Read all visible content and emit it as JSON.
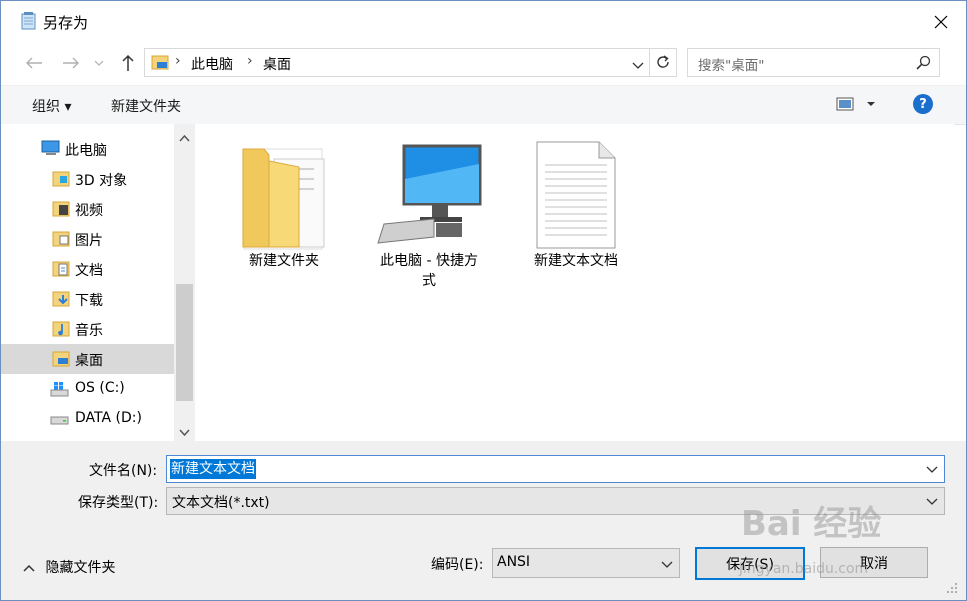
{
  "window": {
    "title": "另存为"
  },
  "address": {
    "crumbs": [
      "此电脑",
      "桌面"
    ]
  },
  "search": {
    "placeholder": "搜索\"桌面\""
  },
  "toolbar": {
    "organize": "组织 ▾",
    "new_folder": "新建文件夹"
  },
  "sidebar": {
    "items": [
      {
        "label": "此电脑",
        "icon": "pc-icon"
      },
      {
        "label": "3D 对象",
        "icon": "3d-objects-icon"
      },
      {
        "label": "视频",
        "icon": "videos-icon"
      },
      {
        "label": "图片",
        "icon": "pictures-icon"
      },
      {
        "label": "文档",
        "icon": "documents-icon"
      },
      {
        "label": "下载",
        "icon": "downloads-icon"
      },
      {
        "label": "音乐",
        "icon": "music-icon"
      },
      {
        "label": "桌面",
        "icon": "desktop-icon",
        "selected": true
      },
      {
        "label": "OS (C:)",
        "icon": "windows-drive-icon"
      },
      {
        "label": "DATA (D:)",
        "icon": "drive-icon"
      }
    ]
  },
  "files": [
    {
      "name": "新建文件夹",
      "icon": "folder-icon"
    },
    {
      "name": "此电脑 - 快捷方式",
      "icon": "computer-shortcut-icon"
    },
    {
      "name": "新建文本文档",
      "icon": "text-file-icon"
    }
  ],
  "form": {
    "filename_label": "文件名(N):",
    "filename_value": "新建文本文档",
    "filetype_label": "保存类型(T):",
    "filetype_value": "文本文档(*.txt)",
    "encoding_label": "编码(E):",
    "encoding_value": "ANSI"
  },
  "footer": {
    "hide_folders": "隐藏文件夹",
    "save": "保存(S)",
    "cancel": "取消"
  },
  "watermark": {
    "brand": "Bai 经验",
    "url": "jingyan.baidu.com"
  },
  "colors": {
    "accent": "#0078d7",
    "selection": "#d9d9d9",
    "help": "#1a6ecc"
  }
}
